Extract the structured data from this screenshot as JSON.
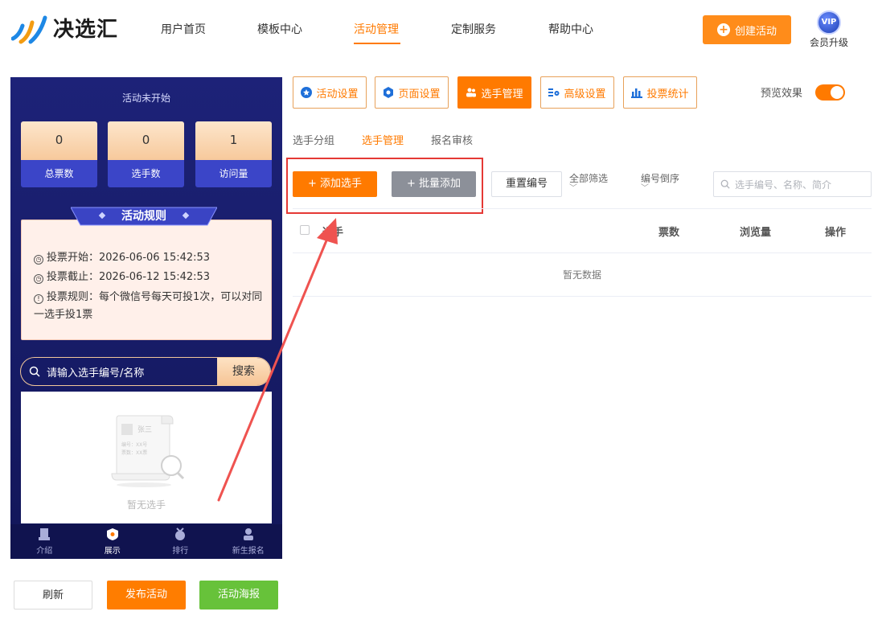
{
  "brand": {
    "name": "决选汇"
  },
  "nav": {
    "items": [
      {
        "label": "用户首页"
      },
      {
        "label": "模板中心"
      },
      {
        "label": "活动管理",
        "active": true
      },
      {
        "label": "定制服务"
      },
      {
        "label": "帮助中心"
      }
    ],
    "create_label": "创建活动",
    "vip_badge": "VIP",
    "vip_label": "会员升级"
  },
  "phone": {
    "status": "活动未开始",
    "stats": [
      {
        "value": "0",
        "label": "总票数"
      },
      {
        "value": "0",
        "label": "选手数"
      },
      {
        "value": "1",
        "label": "访问量"
      }
    ],
    "rules": {
      "title": "活动规则",
      "start": "投票开始：2026-06-06 15:42:53",
      "end": "投票截止：2026-06-12 15:42:53",
      "rule_line1": "投票规则：每个微信号每天可投1次，可以对同",
      "rule_line2": "一选手投1票"
    },
    "search_placeholder": "请输入选手编号/名称",
    "search_button": "搜索",
    "empty": {
      "illustration_name": "张三",
      "illustration_no": "编号：XX号",
      "illustration_votes": "票数：XX票",
      "text": "暂无选手"
    },
    "tabbar": [
      {
        "label": "介绍",
        "icon": "intro-icon"
      },
      {
        "label": "展示",
        "icon": "showcase-icon",
        "active": true
      },
      {
        "label": "排行",
        "icon": "ranking-icon"
      },
      {
        "label": "新生报名",
        "icon": "signup-icon"
      }
    ]
  },
  "bottom": {
    "refresh": "刷新",
    "publish": "发布活动",
    "poster": "活动海报"
  },
  "toolbar": {
    "items": [
      {
        "label": "活动设置",
        "icon": "star-icon"
      },
      {
        "label": "页面设置",
        "icon": "gear-icon"
      },
      {
        "label": "选手管理",
        "icon": "users-icon",
        "active": true
      },
      {
        "label": "高级设置",
        "icon": "settings-list-icon"
      },
      {
        "label": "投票统计",
        "icon": "bar-chart-icon"
      }
    ],
    "preview_label": "预览效果",
    "preview_on": true
  },
  "subtabs": [
    {
      "label": "选手分组"
    },
    {
      "label": "选手管理",
      "active": true
    },
    {
      "label": "报名审核"
    }
  ],
  "actions": {
    "add": "+ 添加选手",
    "batch": "+ 批量添加",
    "renumber": "重置编号",
    "filter": "全部筛选",
    "sort": "编号倒序",
    "search_placeholder": "选手编号、名称、简介"
  },
  "table": {
    "columns": [
      "选手",
      "票数",
      "浏览量",
      "操作"
    ],
    "empty": "暂无数据"
  },
  "colors": {
    "accent": "#ff7a00",
    "annotation": "#e53935",
    "phone_bg": "#1d2278",
    "success": "#67c23a"
  }
}
